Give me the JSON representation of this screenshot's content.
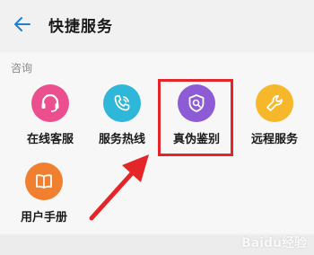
{
  "header": {
    "title": "快捷服务"
  },
  "section": {
    "label": "咨询"
  },
  "services": [
    {
      "label": "在线客服",
      "icon": "headset-icon",
      "color": "#ec4f8e"
    },
    {
      "label": "服务热线",
      "icon": "phone-icon",
      "color": "#2eb7d9"
    },
    {
      "label": "真伪鉴别",
      "icon": "shield-search-icon",
      "color": "#8e5bd6"
    },
    {
      "label": "远程服务",
      "icon": "wrench-icon",
      "color": "#f6b82a"
    },
    {
      "label": "用户手册",
      "icon": "book-icon",
      "color": "#f0802f"
    }
  ],
  "colors": {
    "highlight": "#e4262b",
    "back_arrow": "#1f7fd1"
  },
  "watermark": "Baidu经验"
}
